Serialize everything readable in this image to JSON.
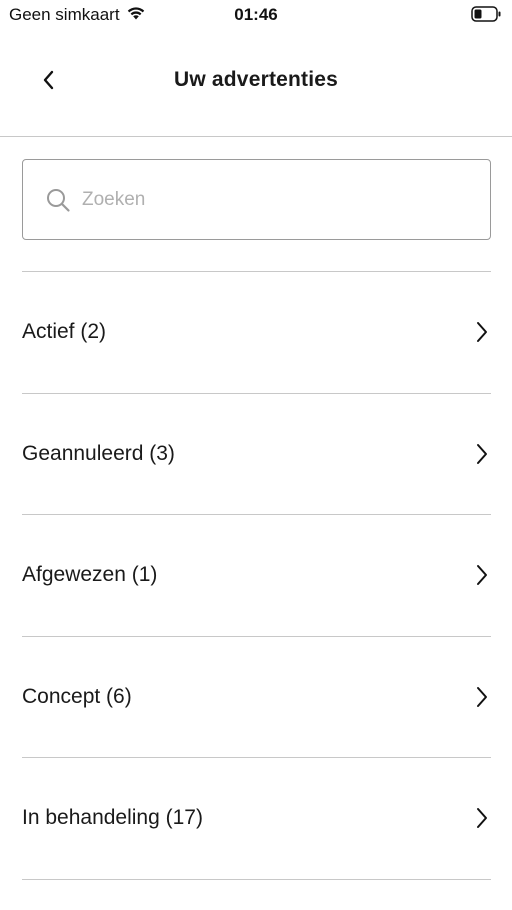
{
  "status_bar": {
    "carrier": "Geen simkaart",
    "time": "01:46",
    "wifi_icon": "wifi-icon",
    "battery_icon": "battery-icon"
  },
  "header": {
    "title": "Uw advertenties",
    "back_icon": "chevron-left-icon"
  },
  "search": {
    "placeholder": "Zoeken",
    "value": "",
    "icon": "search-icon"
  },
  "list": {
    "items": [
      {
        "label": "Actief (2)"
      },
      {
        "label": "Geannuleerd (3)"
      },
      {
        "label": "Afgewezen (1)"
      },
      {
        "label": "Concept (6)"
      },
      {
        "label": "In behandeling (17)"
      }
    ],
    "chevron_icon": "chevron-right-icon"
  },
  "colors": {
    "divider": "#c8c8c8",
    "search_border": "#9a9a9a",
    "placeholder": "#b0b0b0",
    "text": "#1a1a1a"
  }
}
